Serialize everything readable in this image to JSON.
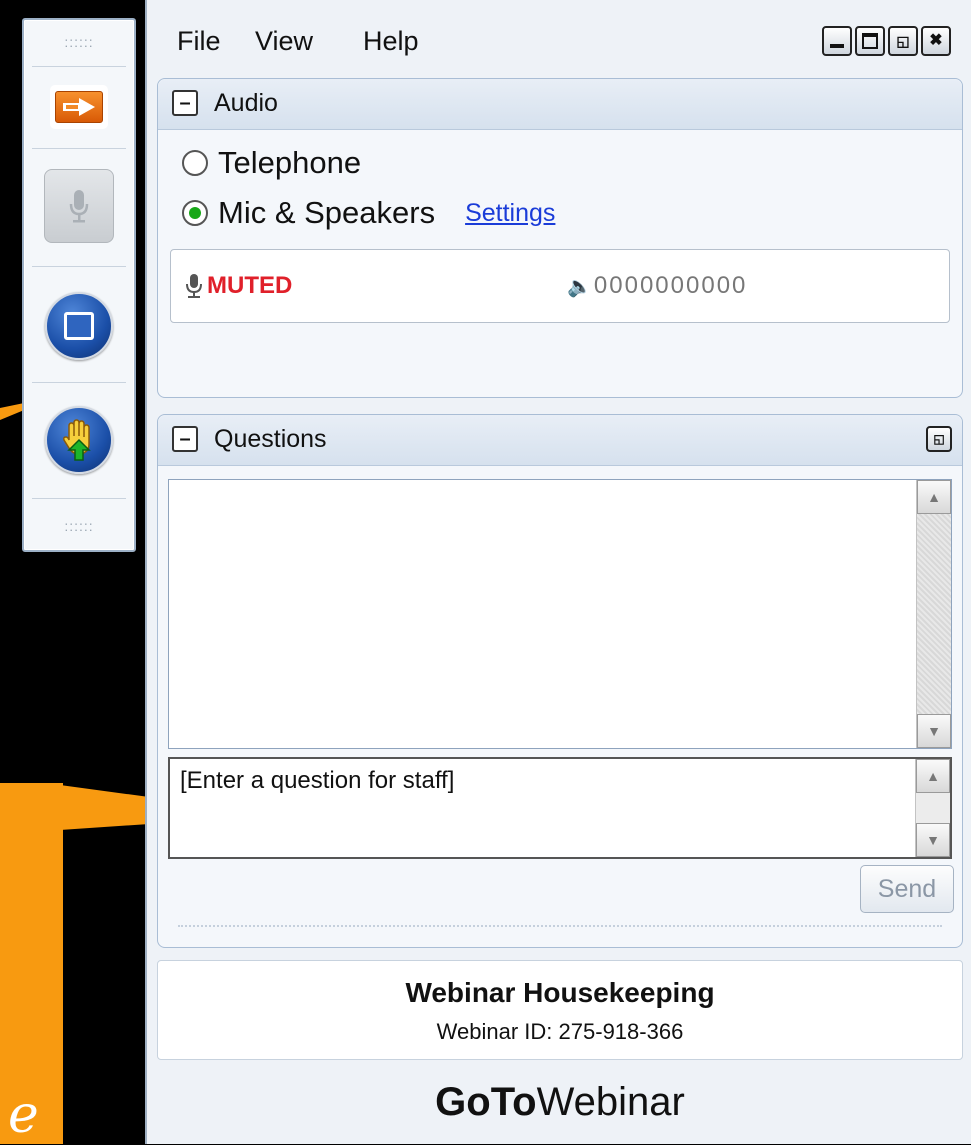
{
  "menu": {
    "file": "File",
    "view": "View",
    "help": "Help"
  },
  "window_buttons": [
    "minimize-icon",
    "maximize-icon",
    "restore-icon",
    "close-icon"
  ],
  "strip": {
    "grip_top": "::::::",
    "grip_bottom": "::::::",
    "buttons": [
      "show-hide-arrow-icon",
      "microphone-icon",
      "screen-share-icon",
      "raise-hand-icon"
    ]
  },
  "audio": {
    "title": "Audio",
    "option_telephone": "Telephone",
    "option_mic": "Mic & Speakers",
    "selected": "Mic & Speakers",
    "settings_link": "Settings",
    "muted_label": "MUTED",
    "volume_meter": "0000000000"
  },
  "questions": {
    "title": "Questions",
    "input_placeholder": "[Enter a question for staff]",
    "send_label": "Send"
  },
  "info": {
    "title": "Webinar Housekeeping",
    "webinar_id": "Webinar ID: 275-918-366"
  },
  "brand": {
    "bold": "GoTo",
    "regular": "Webinar"
  },
  "callout": {
    "partial_text": "e"
  },
  "colors": {
    "accent_orange": "#f89a10",
    "muted_red": "#e0202a",
    "link_blue": "#1a3cd8",
    "panel_bg": "#eef2f7"
  }
}
